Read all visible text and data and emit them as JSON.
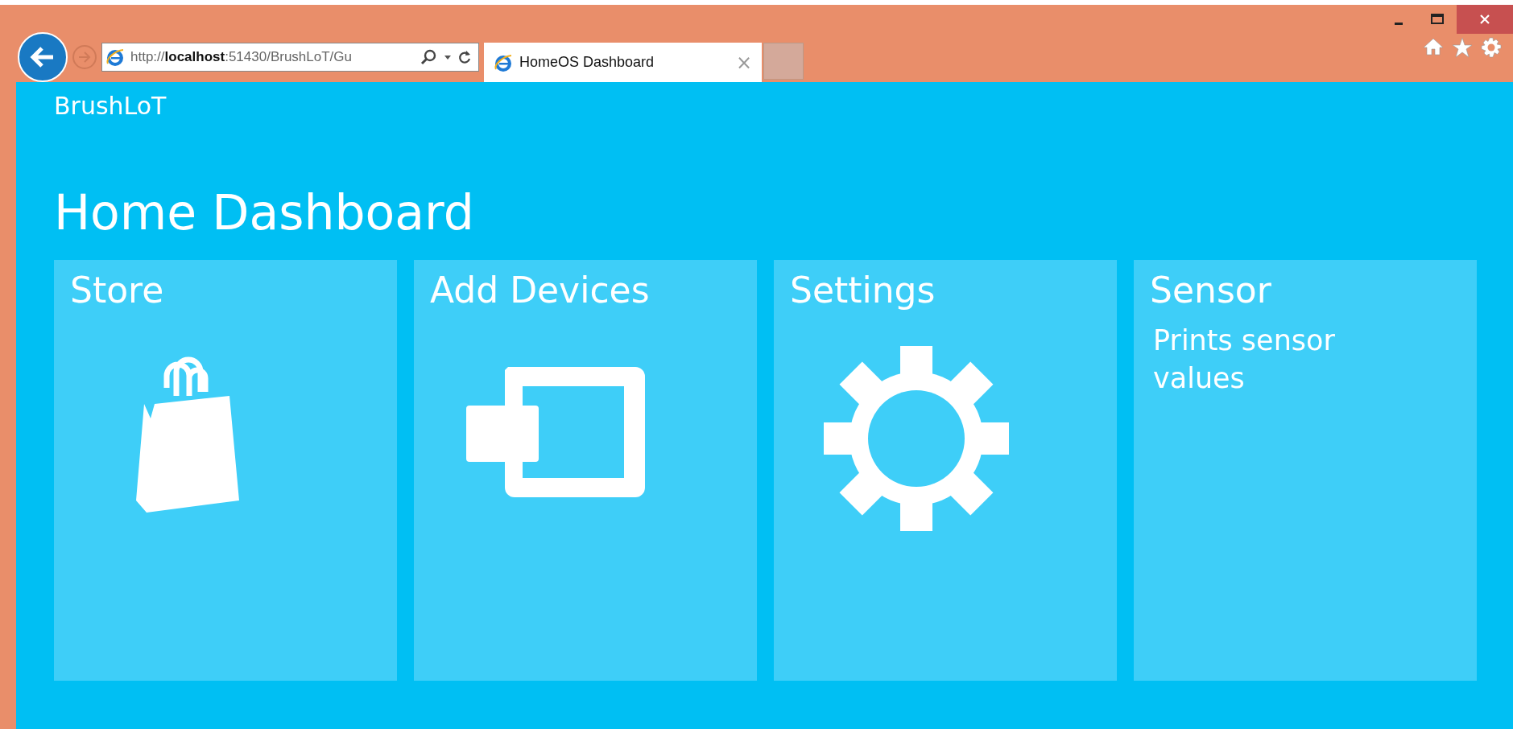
{
  "browser": {
    "address": "http://**localhost**:51430/BrushLoT/Gu",
    "tabs": [
      {
        "title": "HomeOS Dashboard",
        "close": "×",
        "selected": true
      }
    ]
  },
  "page": {
    "brand": "BrushLoT",
    "heading": "Home Dashboard",
    "tiles": [
      {
        "title": "Store",
        "kind": "store"
      },
      {
        "title": "Add Devices",
        "kind": "devices"
      },
      {
        "title": "Settings",
        "kind": "settings"
      },
      {
        "title": "Sensor",
        "kind": "text",
        "description": "Prints sensor values"
      }
    ]
  }
}
